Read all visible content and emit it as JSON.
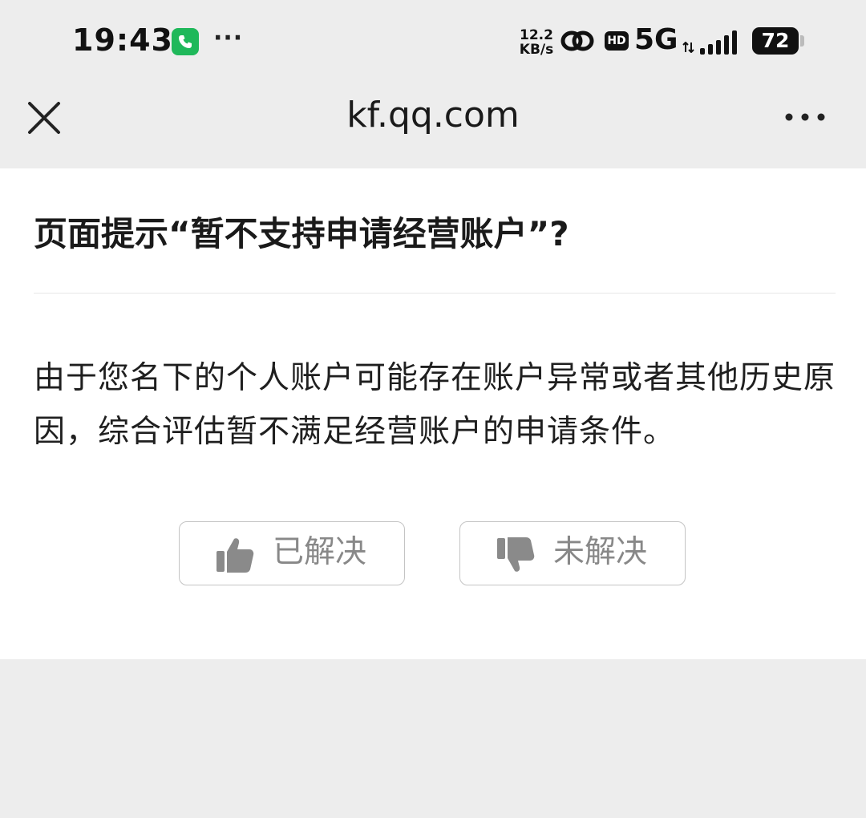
{
  "status_bar": {
    "time": "19:43",
    "net_speed_value": "12.2",
    "net_speed_unit": "KB/s",
    "hd_label": "HD",
    "network_type": "5G",
    "battery_level": "72",
    "icons": [
      "phone-call-icon",
      "more-dots-icon",
      "link-icon",
      "hd-icon",
      "data-arrows-icon",
      "signal-icon",
      "battery-icon"
    ]
  },
  "nav": {
    "title": "kf.qq.com",
    "close_icon": "close-icon",
    "menu_icon": "more-menu-icon"
  },
  "article": {
    "title": "页面提示“暂不支持申请经营账户”?",
    "body": "由于您名下的个人账户可能存在账户异常或者其他历史原因，综合评估暂不满足经营账户的申请条件。"
  },
  "feedback": {
    "solved_label": "已解决",
    "unsolved_label": "未解决",
    "solved_icon": "thumbs-up-icon",
    "unsolved_icon": "thumbs-down-icon"
  },
  "colors": {
    "page_background": "#ededed",
    "card_background": "#ffffff",
    "button_text": "#888888",
    "call_badge": "#1fb85a"
  }
}
